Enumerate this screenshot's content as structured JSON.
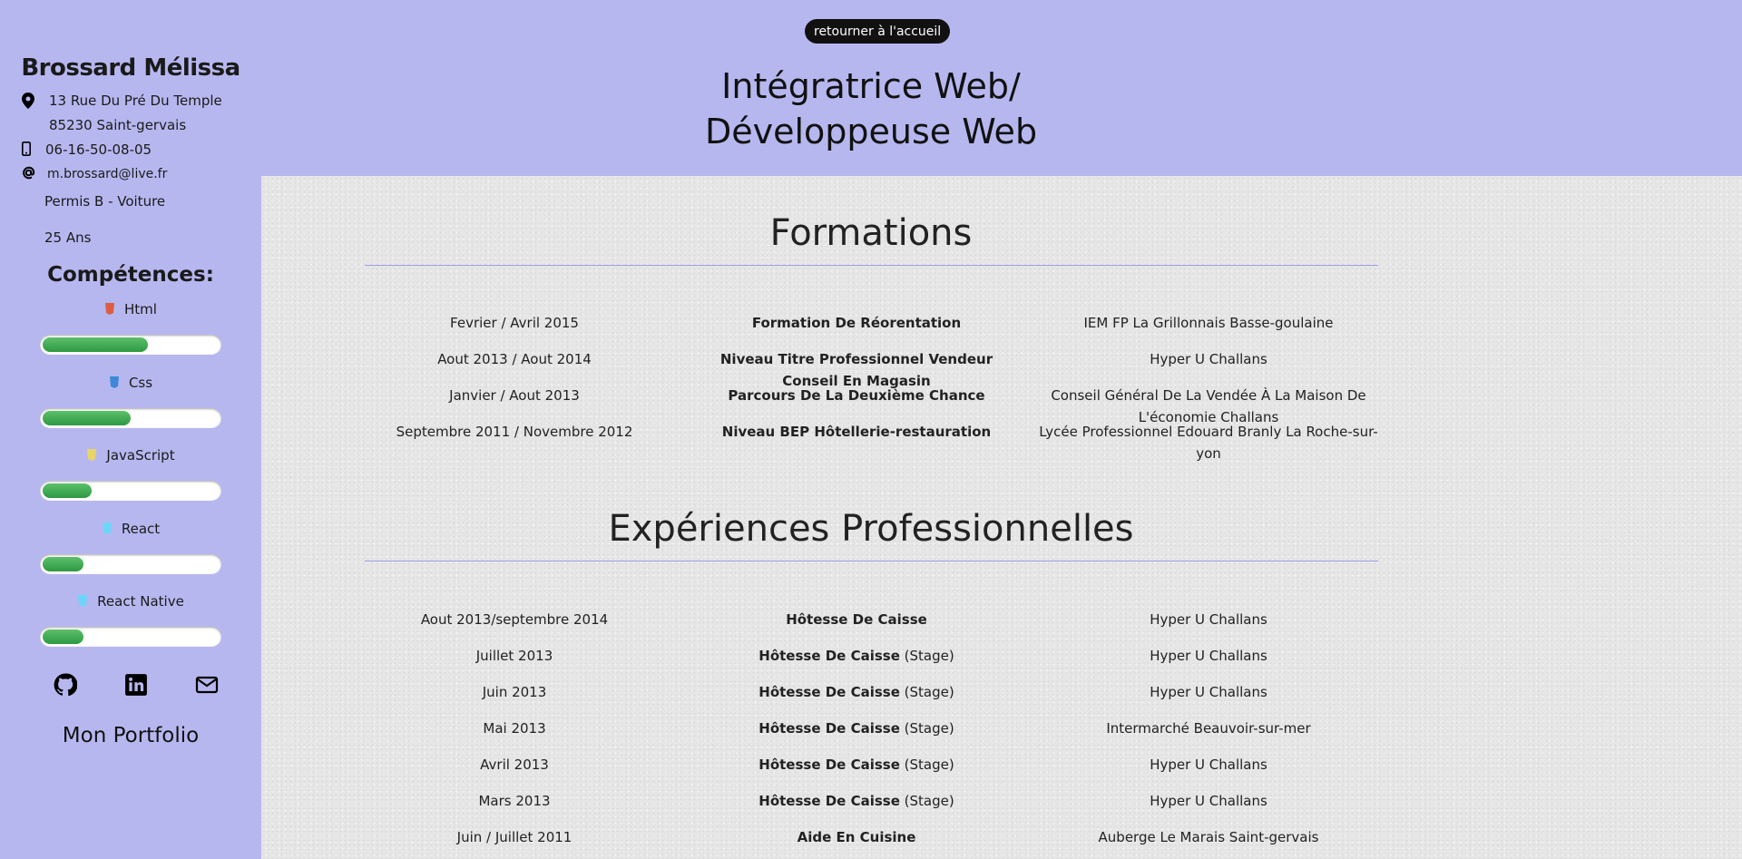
{
  "profile": {
    "name": "Brossard Mélissa",
    "address_line1": "13 Rue Du Pré Du Temple",
    "address_line2": "85230 Saint-gervais",
    "phone": "06-16-50-08-05",
    "email": "m.brossard@live.fr",
    "license": "Permis B - Voiture",
    "age": "25 Ans"
  },
  "skills": {
    "title": "Compétences:",
    "items": [
      {
        "label": "Html",
        "icon": "html5-icon",
        "color": "#e44d26",
        "level": 0.6
      },
      {
        "label": "Css",
        "icon": "css3-icon",
        "color": "#2a7fd4",
        "level": 0.5
      },
      {
        "label": "JavaScript",
        "icon": "javascript-icon",
        "color": "#f0db4f",
        "level": 0.28
      },
      {
        "label": "React",
        "icon": "react-icon",
        "color": "#61dafb",
        "level": 0.23
      },
      {
        "label": "React Native",
        "icon": "react-native-icon",
        "color": "#61dafb",
        "level": 0.23
      }
    ]
  },
  "social": {
    "icons": [
      "github-icon",
      "linkedin-icon",
      "mail-icon"
    ]
  },
  "portfolio_link": "Mon Portfolio",
  "header": {
    "home_button": "retourner à l'accueil",
    "title_line1": "Intégratrice Web/",
    "title_line2": "Développeuse Web"
  },
  "formations": {
    "title": "Formations",
    "rows": [
      {
        "date": "Fevrier / Avril 2015",
        "title": "Formation De Réorentation",
        "place": "IEM FP La Grillonnais Basse-goulaine"
      },
      {
        "date": "Aout 2013 / Aout 2014",
        "title": "Niveau Titre Professionnel Vendeur Conseil En Magasin",
        "place": "Hyper U Challans"
      },
      {
        "date": "Janvier / Aout 2013",
        "title": "Parcours De La Deuxième Chance",
        "place": "Conseil Général De La Vendée À La Maison De L'économie Challans"
      },
      {
        "date": "Septembre 2011 / Novembre 2012",
        "title": "Niveau BEP Hôtellerie-restauration",
        "place": "Lycée Professionnel Edouard Branly La Roche-sur-yon"
      }
    ]
  },
  "experiences": {
    "title": "Expériences Professionnelles",
    "rows": [
      {
        "date": "Aout 2013/septembre 2014",
        "title": "Hôtesse De Caisse",
        "note": "",
        "place": "Hyper U Challans"
      },
      {
        "date": "Juillet 2013",
        "title": "Hôtesse De Caisse",
        "note": " (Stage)",
        "place": "Hyper U Challans"
      },
      {
        "date": "Juin 2013",
        "title": "Hôtesse De Caisse",
        "note": " (Stage)",
        "place": "Hyper U Challans"
      },
      {
        "date": "Mai 2013",
        "title": "Hôtesse De Caisse",
        "note": " (Stage)",
        "place": "Intermarché Beauvoir-sur-mer"
      },
      {
        "date": "Avril 2013",
        "title": "Hôtesse De Caisse",
        "note": " (Stage)",
        "place": "Hyper U Challans"
      },
      {
        "date": "Mars 2013",
        "title": "Hôtesse De Caisse",
        "note": " (Stage)",
        "place": "Hyper U Challans"
      },
      {
        "date": "Juin / Juillet 2011",
        "title": "Aide En Cuisine",
        "note": "",
        "place": "Auberge Le Marais Saint-gervais"
      }
    ]
  }
}
